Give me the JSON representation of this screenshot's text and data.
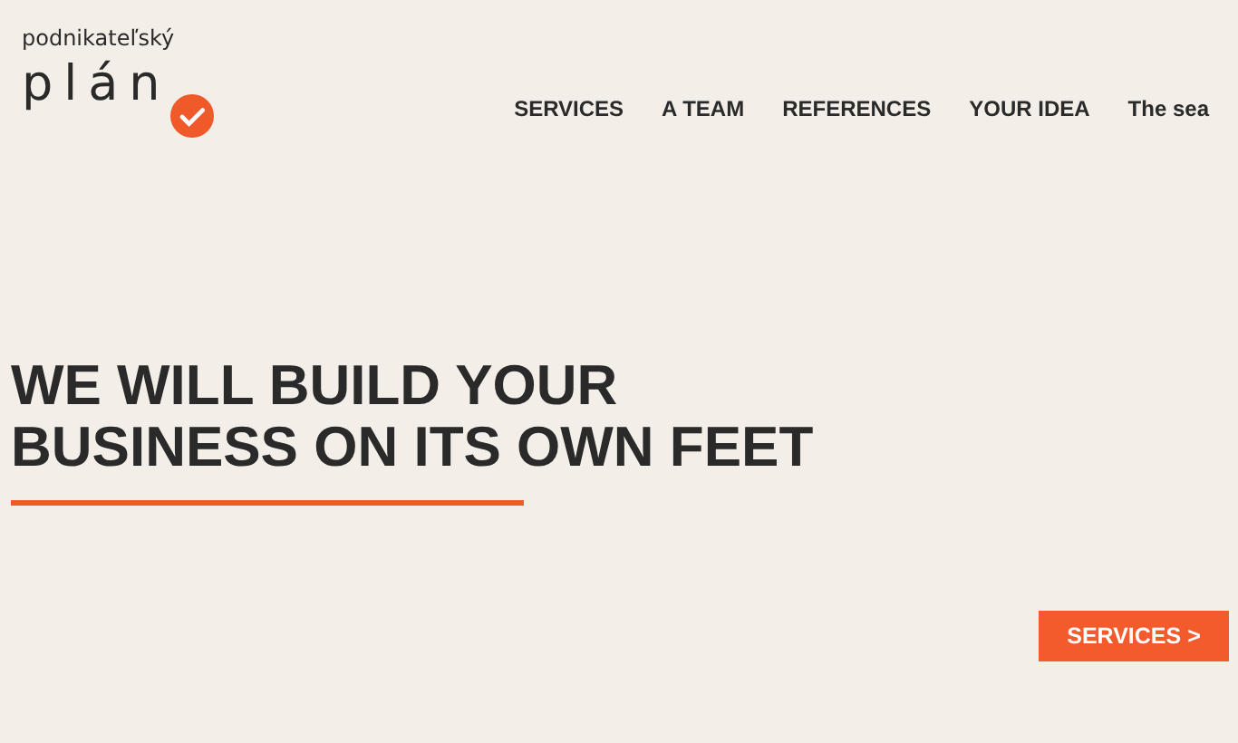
{
  "logo": {
    "tagline": "podnikateľský",
    "word": "plán"
  },
  "nav": [
    {
      "label": "SERVICES"
    },
    {
      "label": "A TEAM"
    },
    {
      "label": "REFERENCES"
    },
    {
      "label": "YOUR IDEA"
    },
    {
      "label": "The sea"
    }
  ],
  "hero": {
    "headline_lines": [
      "WE WILL BUILD YOUR",
      "BUSINESS ON ITS OWN FEET"
    ],
    "button": "SERVICES >"
  }
}
